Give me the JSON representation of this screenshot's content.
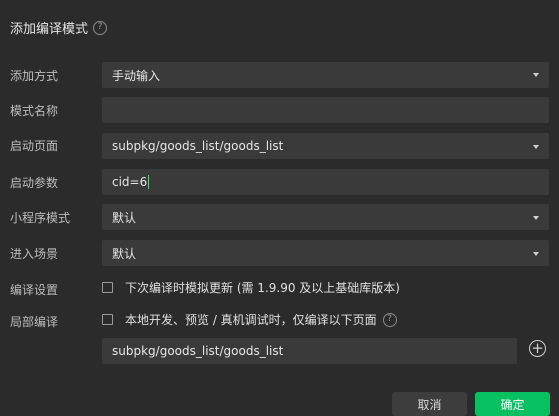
{
  "dialog": {
    "title": "添加编译模式",
    "help_glyph": "?"
  },
  "form": {
    "add_method": {
      "label": "添加方式",
      "value": "手动输入"
    },
    "mode_name": {
      "label": "模式名称",
      "value": ""
    },
    "start_page": {
      "label": "启动页面",
      "value": "subpkg/goods_list/goods_list"
    },
    "start_params": {
      "label": "启动参数",
      "value": "cid=6"
    },
    "miniprogram_mode": {
      "label": "小程序模式",
      "value": "默认"
    },
    "scene": {
      "label": "进入场景",
      "value": "默认"
    },
    "compile_settings": {
      "label": "编译设置",
      "checkbox_text": "下次编译时模拟更新 (需 1.9.90 及以上基础库版本)",
      "checked": false
    },
    "partial_compile": {
      "label": "局部编译",
      "checkbox_text": "本地开发、预览 / 真机调试时，仅编译以下页面",
      "checked": false,
      "page_value": "subpkg/goods_list/goods_list"
    }
  },
  "icons": {
    "dropdown": "chevron-down-icon",
    "help": "question-circle-icon",
    "add": "plus-circle-icon",
    "plus_glyph": "+"
  },
  "buttons": {
    "cancel": "取消",
    "confirm": "确定"
  },
  "colors": {
    "background": "#2b2b2b",
    "field": "#3a3a3a",
    "primary": "#07c160",
    "cursor": "#4cd964"
  }
}
